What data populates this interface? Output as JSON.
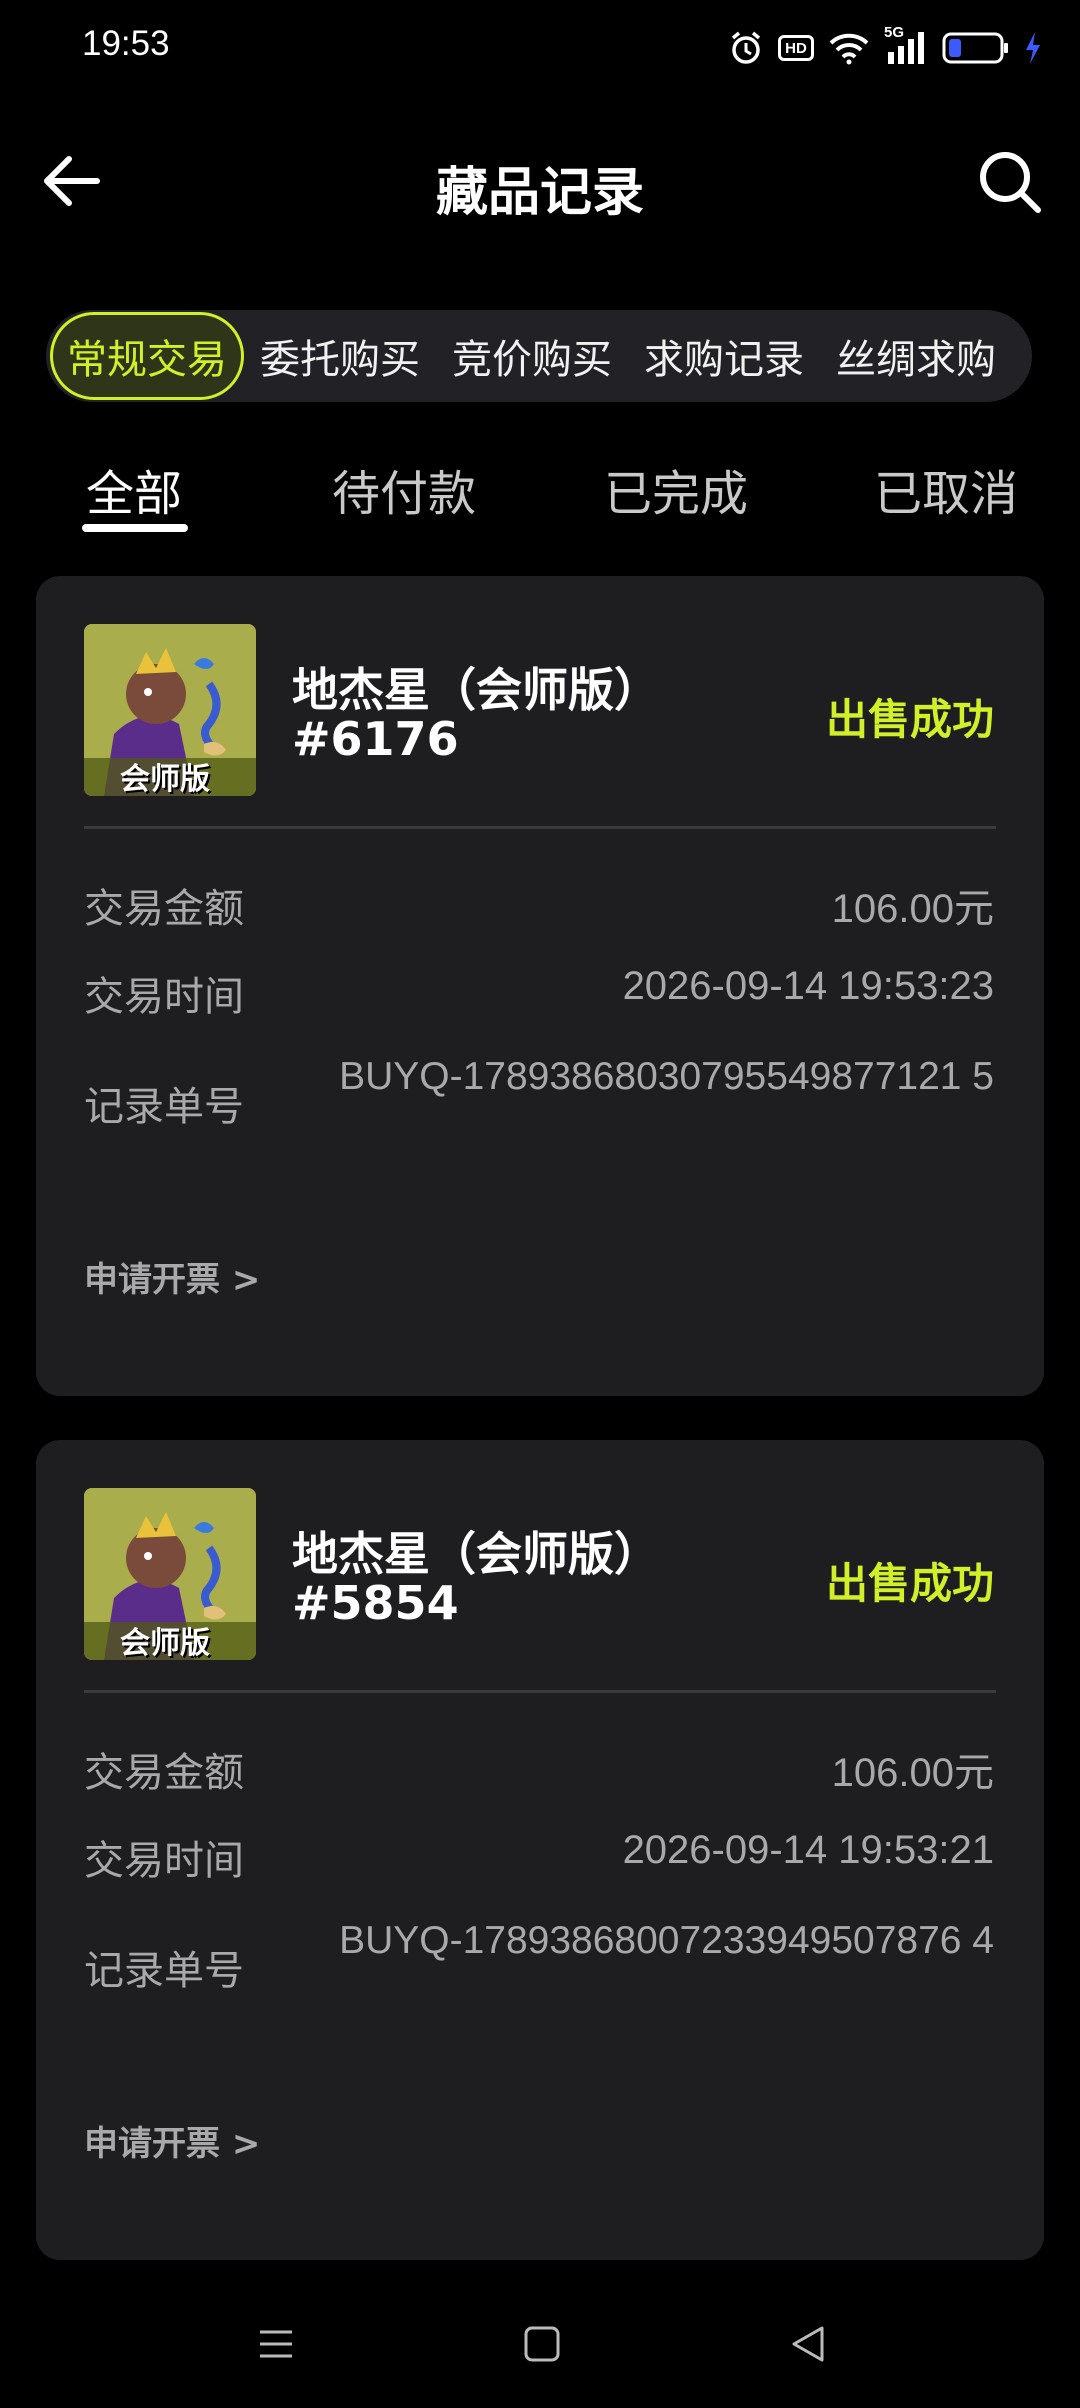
{
  "status_bar": {
    "time": "19:53",
    "network": "5G",
    "hd": "HD"
  },
  "header": {
    "title": "藏品记录"
  },
  "category_tabs": [
    "常规交易",
    "委托购买",
    "竞价购买",
    "求购记录",
    "丝绸求购"
  ],
  "filter_tabs": [
    "全部",
    "待付款",
    "已完成",
    "已取消"
  ],
  "labels": {
    "amount": "交易金额",
    "time": "交易时间",
    "order_no": "记录单号",
    "invoice": "申请开票 >"
  },
  "records": [
    {
      "name": "地杰星（会师版）",
      "serial": "#6176",
      "status": "出售成功",
      "thumb_caption": "会师版",
      "amount": "106.00元",
      "time": "2026-09-14 19:53:23",
      "order_no": "BUYQ-17893868030795549877121 5"
    },
    {
      "name": "地杰星（会师版）",
      "serial": "#5854",
      "status": "出售成功",
      "thumb_caption": "会师版",
      "amount": "106.00元",
      "time": "2026-09-14 19:53:21",
      "order_no": "BUYQ-17893868007233949507876 4"
    }
  ],
  "colors": {
    "accent": "#d2f028",
    "card_bg": "#1e1e21",
    "page_bg": "#000000"
  }
}
